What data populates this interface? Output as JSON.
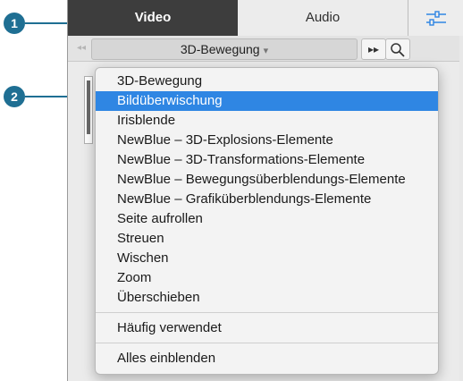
{
  "callouts": [
    "1",
    "2"
  ],
  "tabs": {
    "video": "Video",
    "audio": "Audio"
  },
  "icons": {
    "settings": "sliders-icon",
    "prev": "double-chevron-left-icon",
    "next": "double-chevron-right-icon",
    "search": "magnifier-icon",
    "caret": "chevron-down-icon"
  },
  "toolbar": {
    "category": "3D-Bewegung",
    "prev_glyph": "◂◂",
    "next_glyph": "▸▸"
  },
  "menu": {
    "items": [
      "3D-Bewegung",
      "Bildüberwischung",
      "Irisblende",
      "NewBlue – 3D-Explosions-Elemente",
      "NewBlue – 3D-Transformations-Elemente",
      "NewBlue – Bewegungsüberblendungs-Elemente",
      "NewBlue – Grafiküberblendungs-Elemente",
      "Seite aufrollen",
      "Streuen",
      "Wischen",
      "Zoom",
      "Überschieben"
    ],
    "selected": "Bildüberwischung",
    "frequent": "Häufig verwendet",
    "show_all": "Alles einblenden"
  },
  "colors": {
    "accent": "#2f86e3",
    "callout": "#1f6f93",
    "active_tab": "#3d3d3d"
  }
}
